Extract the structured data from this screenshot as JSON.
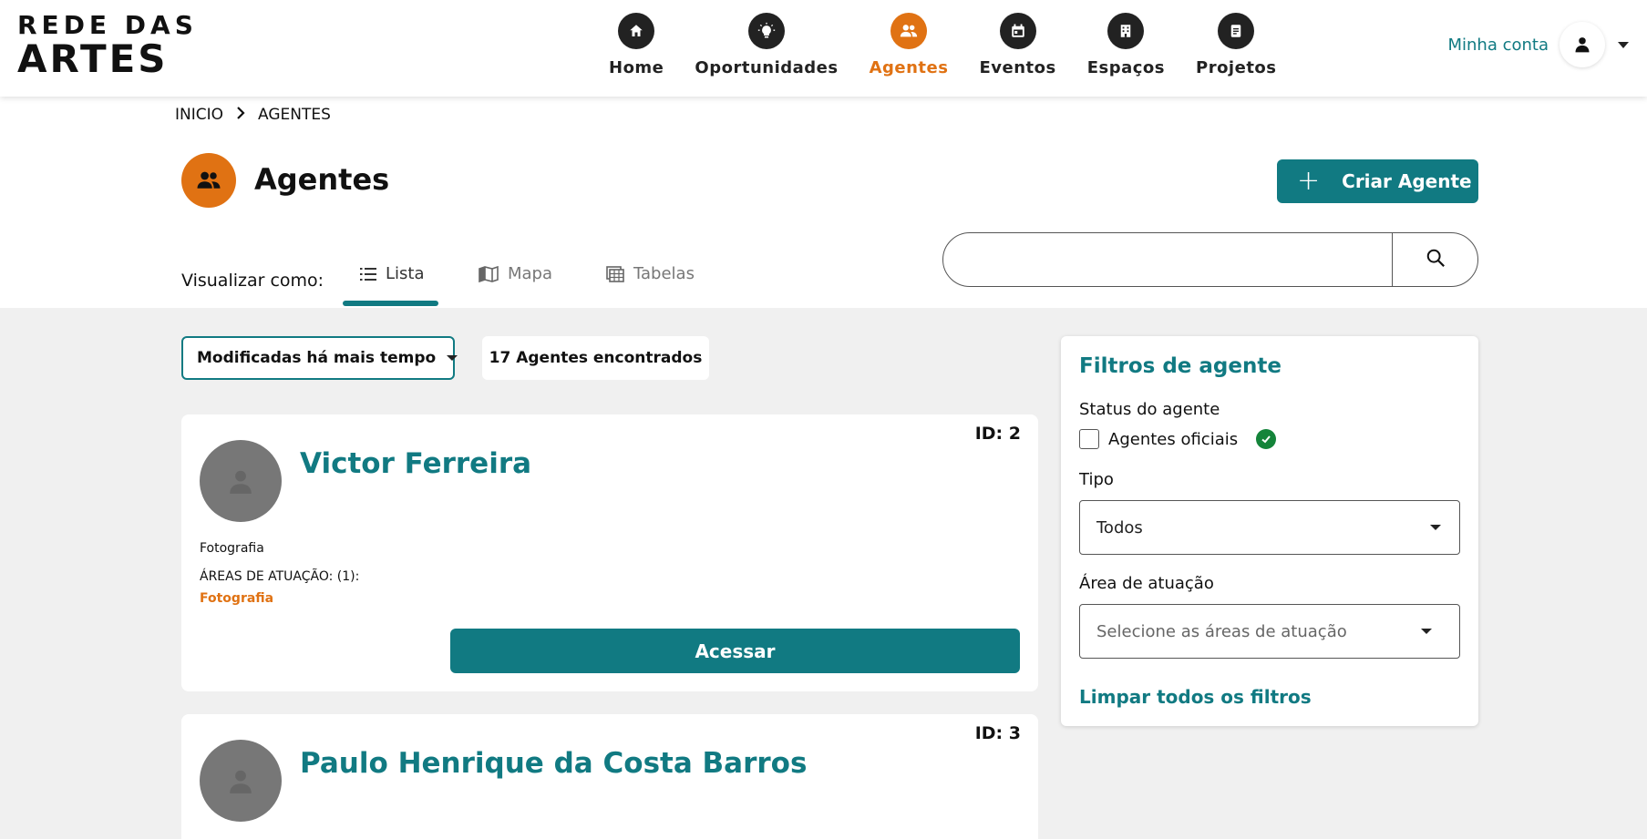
{
  "brand": {
    "logo_line1": "REDE DAS",
    "logo_line2": "ARTES"
  },
  "nav": {
    "items": [
      {
        "label": "Home",
        "icon": "home-icon"
      },
      {
        "label": "Oportunidades",
        "icon": "lightbulb-icon"
      },
      {
        "label": "Agentes",
        "icon": "users-icon",
        "active": true
      },
      {
        "label": "Eventos",
        "icon": "calendar-icon"
      },
      {
        "label": "Espaços",
        "icon": "building-icon"
      },
      {
        "label": "Projetos",
        "icon": "document-icon"
      }
    ],
    "account_label": "Minha conta"
  },
  "breadcrumb": {
    "home": "INICIO",
    "current": "AGENTES"
  },
  "page": {
    "title": "Agentes",
    "create_button": "Criar Agente"
  },
  "view": {
    "label": "Visualizar como:",
    "tabs": [
      {
        "label": "Lista",
        "active": true
      },
      {
        "label": "Mapa"
      },
      {
        "label": "Tabelas"
      }
    ]
  },
  "search": {
    "placeholder": ""
  },
  "listing": {
    "sort_value": "Modificadas há mais tempo",
    "count_text": "17 Agentes encontrados"
  },
  "agents": [
    {
      "id_text": "ID: 2",
      "name": "Victor Ferreira",
      "type": "Fotografia",
      "areas_label": "ÁREAS DE ATUAÇÃO: (1):",
      "areas_value": "Fotografia",
      "access_label": "Acessar"
    },
    {
      "id_text": "ID: 3",
      "name": "Paulo Henrique da Costa Barros"
    }
  ],
  "filters": {
    "title": "Filtros de agente",
    "status_label": "Status do agente",
    "official_label": "Agentes oficiais",
    "type_label": "Tipo",
    "type_value": "Todos",
    "area_label": "Área de atuação",
    "area_placeholder": "Selecione as áreas de atuação",
    "clear_label": "Limpar todos os filtros"
  },
  "colors": {
    "accent_teal": "#117a82",
    "accent_orange": "#e07213",
    "verified_green": "#14843a"
  }
}
